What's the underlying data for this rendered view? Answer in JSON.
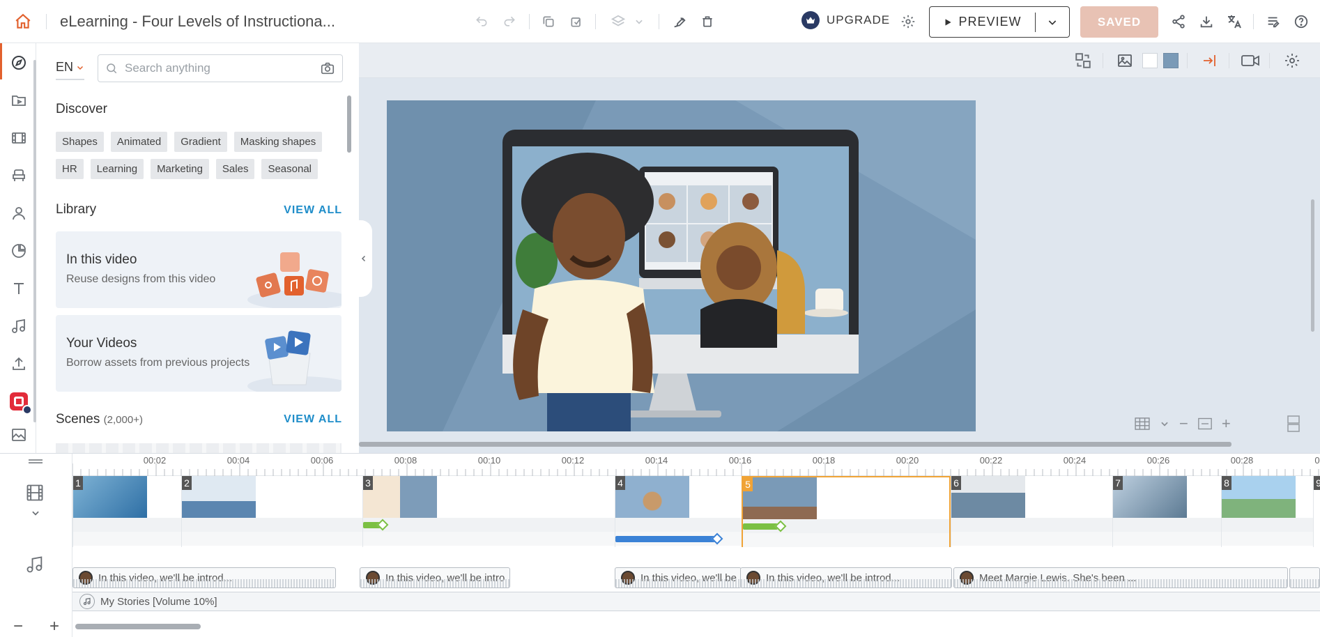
{
  "app": {
    "title": "eLearning - Four Levels of Instructiona...",
    "upgrade_label": "UPGRADE",
    "preview_label": "PREVIEW",
    "saved_label": "SAVED"
  },
  "panel": {
    "language": "EN",
    "search_placeholder": "Search anything",
    "discover_heading": "Discover",
    "tags": [
      "Shapes",
      "Animated",
      "Gradient",
      "Masking shapes",
      "HR",
      "Learning",
      "Marketing",
      "Sales",
      "Seasonal"
    ],
    "library_heading": "Library",
    "library_view_all": "VIEW ALL",
    "cards": [
      {
        "title": "In this video",
        "subtitle": "Reuse designs from this video"
      },
      {
        "title": "Your Videos",
        "subtitle": "Borrow assets from previous projects"
      }
    ],
    "scenes_heading": "Scenes",
    "scenes_count": "(2,000+)",
    "scenes_view_all": "VIEW ALL"
  },
  "timeline": {
    "ticks": [
      "00:02",
      "00:04",
      "00:06",
      "00:08",
      "00:10",
      "00:12",
      "00:14",
      "00:16",
      "00:18",
      "00:20",
      "00:22",
      "00:24",
      "00:26",
      "00:28",
      "0"
    ],
    "scenes": [
      "1",
      "2",
      "3",
      "4",
      "5",
      "6",
      "7",
      "8",
      "9"
    ],
    "selected_scene": "5",
    "audio_clips": [
      "In this video, we'll be introd...",
      "In this video, we'll be intro",
      "In this video, we'll be",
      "In this video, we'll be introd...",
      "Meet Margie Lewis. She's been ..."
    ],
    "music_track": "My Stories [Volume 10%]",
    "zoom_out": "−",
    "zoom_in": "+"
  },
  "colors": {
    "accent_orange": "#e2612e",
    "selected_scene": "#f0a336",
    "link_blue": "#1f8dc9",
    "saved_bg": "#e8c2b4",
    "stage_bg": "#7a9ab7"
  }
}
